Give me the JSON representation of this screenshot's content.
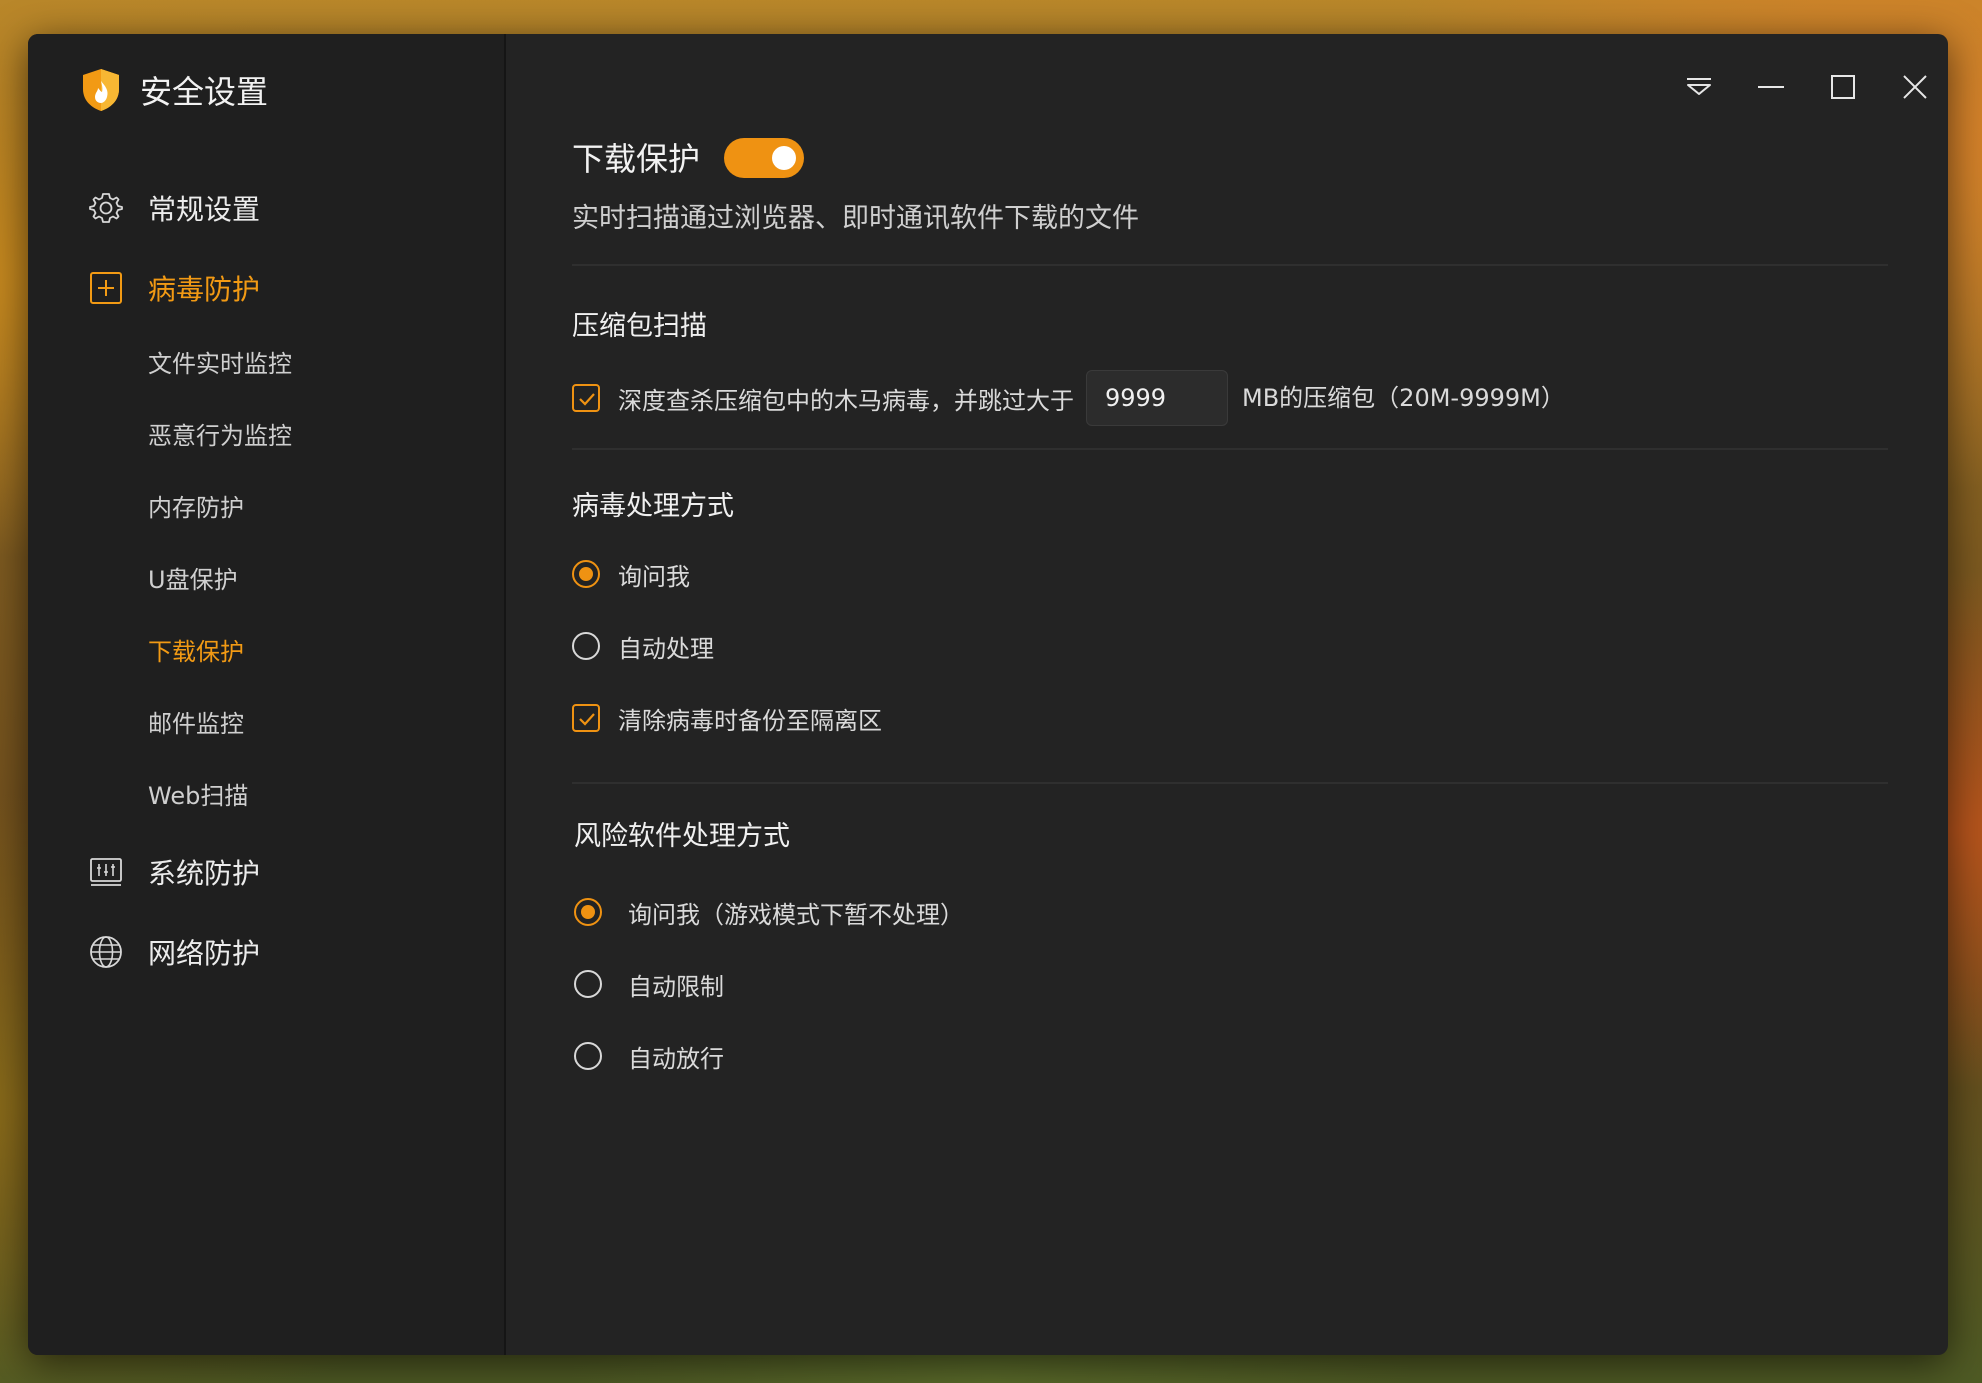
{
  "app": {
    "title": "安全设置"
  },
  "sidebar": {
    "general": "常规设置",
    "virus": "病毒防护",
    "sub_items": [
      "文件实时监控",
      "恶意行为监控",
      "内存防护",
      "U盘保护",
      "下载保护",
      "邮件监控",
      "Web扫描"
    ],
    "active_sub": "下载保护",
    "system": "系统防护",
    "network": "网络防护"
  },
  "main": {
    "title": "下载保护",
    "toggle_on": true,
    "description": "实时扫描通过浏览器、即时通讯软件下载的文件",
    "archive": {
      "title": "压缩包扫描",
      "checkbox_label": "深度查杀压缩包中的木马病毒，并跳过大于",
      "size_value": "9999",
      "suffix": "MB的压缩包（20M-9999M）"
    },
    "virus_handling": {
      "title": "病毒处理方式",
      "options": [
        "询问我",
        "自动处理"
      ],
      "selected": 0,
      "backup_label": "清除病毒时备份至隔离区"
    },
    "risk_handling": {
      "title": "风险软件处理方式",
      "options": [
        "询问我（游戏模式下暂不处理）",
        "自动限制",
        "自动放行"
      ],
      "selected": 0
    }
  },
  "colors": {
    "accent": "#ef9212",
    "window_bg": "#232323",
    "sidebar_bg": "#1f1f1f"
  }
}
